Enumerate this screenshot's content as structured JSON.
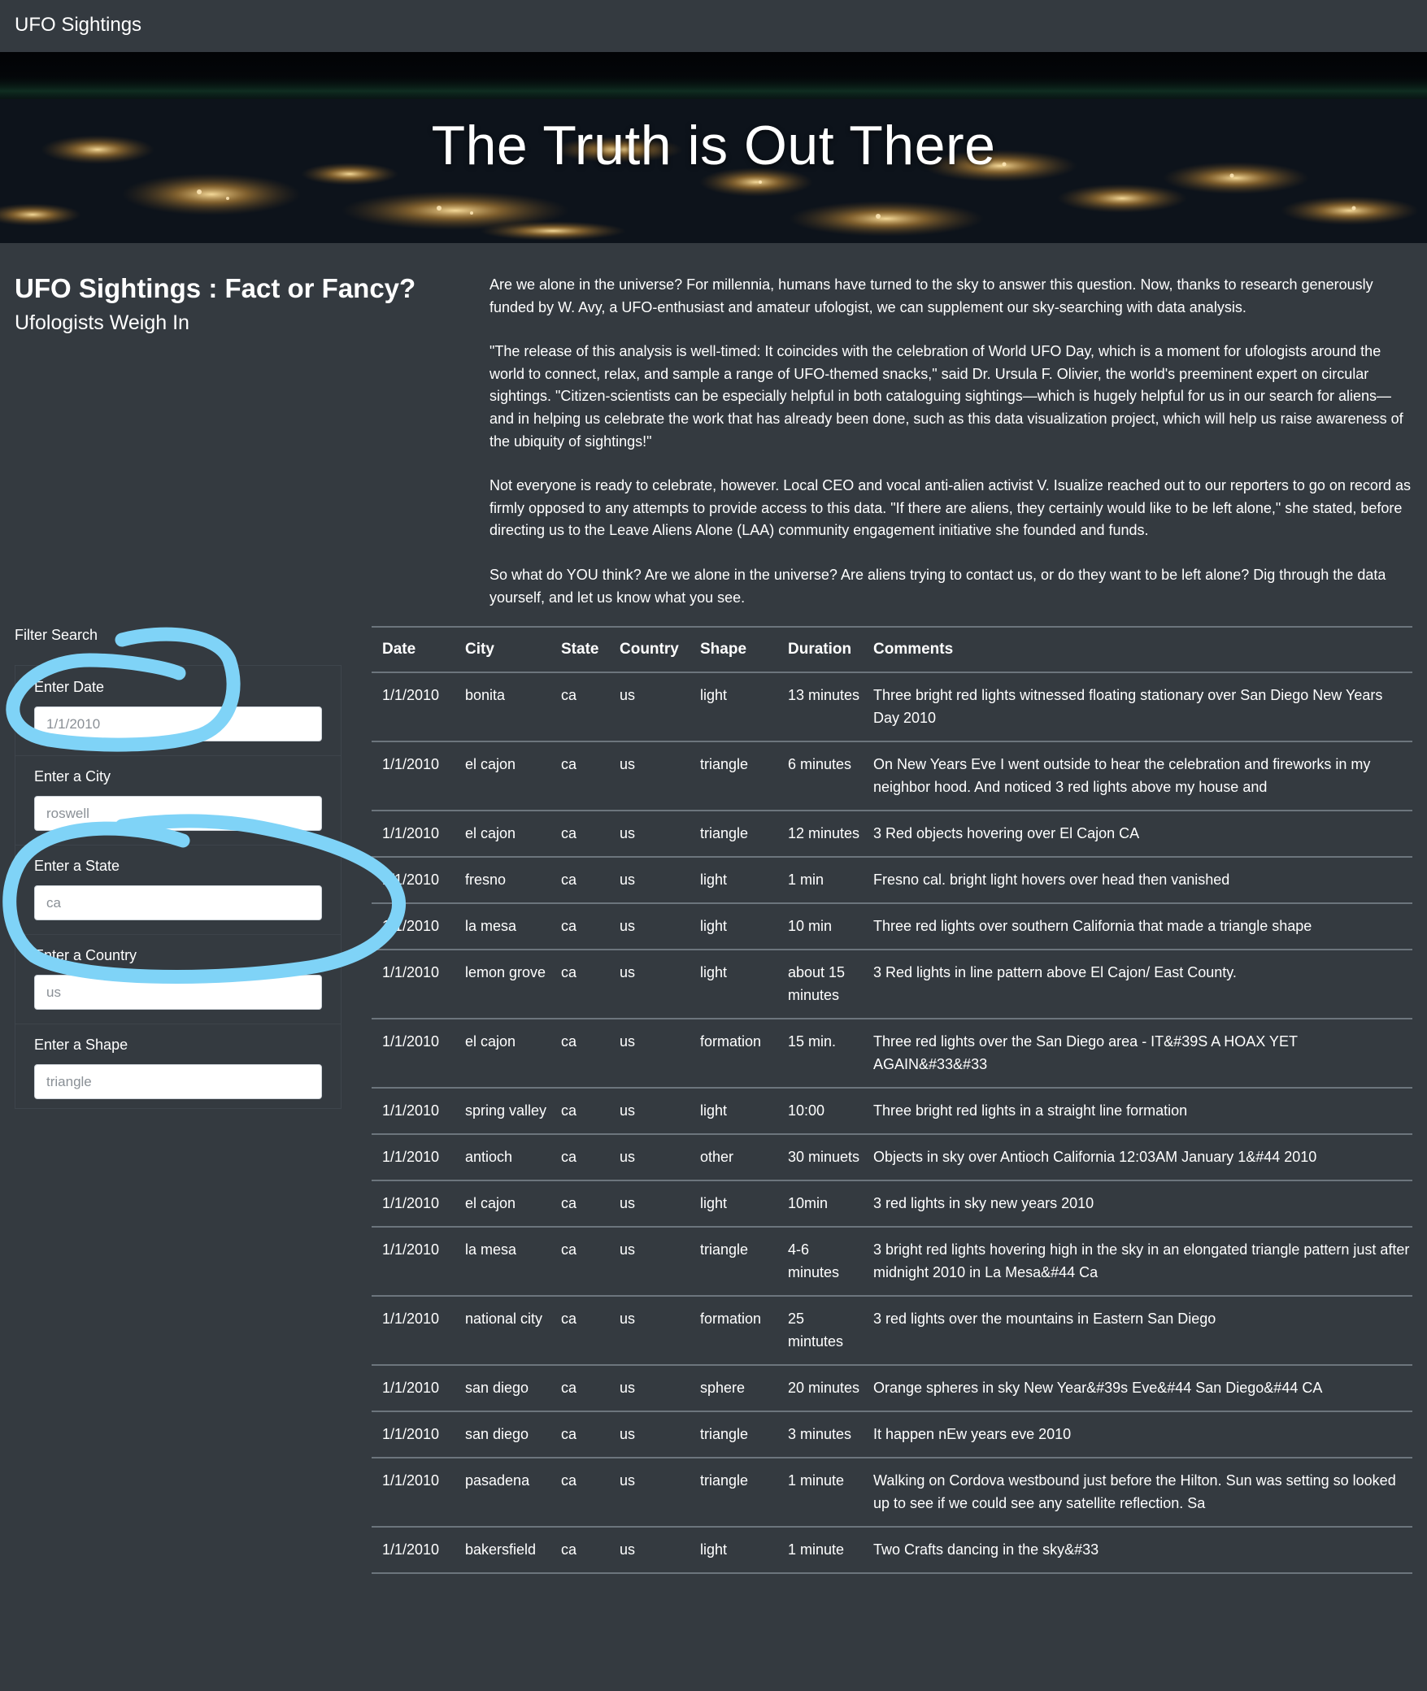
{
  "navbar": {
    "brand": "UFO Sightings"
  },
  "hero": {
    "title": "The Truth is Out There"
  },
  "intro": {
    "title": "UFO Sightings : Fact or Fancy?",
    "subtitle": "Ufologists Weigh In",
    "paragraphs": [
      "Are we alone in the universe? For millennia, humans have turned to the sky to answer this question. Now, thanks to research generously funded by W. Avy, a UFO-enthusiast and amateur ufologist, we can supplement our sky-searching with data analysis.",
      "\"The release of this analysis is well-timed: It coincides with the celebration of World UFO Day, which is a moment for ufologists around the world to connect, relax, and sample a range of UFO-themed snacks,\" said Dr. Ursula F. Olivier, the world's preeminent expert on circular sightings. \"Citizen-scientists can be especially helpful in both cataloguing sightings—which is hugely helpful for us in our search for aliens—and in helping us celebrate the work that has already been done, such as this data visualization project, which will help us raise awareness of the ubiquity of sightings!\"",
      "Not everyone is ready to celebrate, however. Local CEO and vocal anti-alien activist V. Isualize reached out to our reporters to go on record as firmly opposed to any attempts to provide access to this data. \"If there are aliens, they certainly would like to be left alone,\" she stated, before directing us to the Leave Aliens Alone (LAA) community engagement initiative she founded and funds.",
      "So what do YOU think? Are we alone in the universe? Are aliens trying to contact us, or do they want to be left alone? Dig through the data yourself, and let us know what you see."
    ]
  },
  "filters": {
    "heading": "Filter Search",
    "items": [
      {
        "label": "Enter Date",
        "placeholder": "1/1/2010"
      },
      {
        "label": "Enter a City",
        "placeholder": "roswell"
      },
      {
        "label": "Enter a State",
        "placeholder": "ca"
      },
      {
        "label": "Enter a Country",
        "placeholder": "us"
      },
      {
        "label": "Enter a Shape",
        "placeholder": "triangle"
      }
    ]
  },
  "table": {
    "headers": [
      "Date",
      "City",
      "State",
      "Country",
      "Shape",
      "Duration",
      "Comments"
    ],
    "rows": [
      [
        "1/1/2010",
        "bonita",
        "ca",
        "us",
        "light",
        "13 minutes",
        "Three bright red lights witnessed floating stationary over San Diego New Years Day 2010"
      ],
      [
        "1/1/2010",
        "el cajon",
        "ca",
        "us",
        "triangle",
        "6 minutes",
        "On New Years Eve I went outside to hear the celebration and fireworks in my neighbor hood. And noticed 3 red lights above my house and"
      ],
      [
        "1/1/2010",
        "el cajon",
        "ca",
        "us",
        "triangle",
        "12 minutes",
        "3 Red objects hovering over El Cajon CA"
      ],
      [
        "1/1/2010",
        "fresno",
        "ca",
        "us",
        "light",
        "1 min",
        "Fresno cal. bright light hovers over head then vanished"
      ],
      [
        "1/1/2010",
        "la mesa",
        "ca",
        "us",
        "light",
        "10 min",
        "Three red lights over southern California that made a triangle shape"
      ],
      [
        "1/1/2010",
        "lemon grove",
        "ca",
        "us",
        "light",
        "about 15 minutes",
        "3 Red lights in line pattern above El Cajon/ East County."
      ],
      [
        "1/1/2010",
        "el cajon",
        "ca",
        "us",
        "formation",
        "15 min.",
        "Three red lights over the San Diego area - IT&#39S A HOAX YET AGAIN&#33&#33"
      ],
      [
        "1/1/2010",
        "spring valley",
        "ca",
        "us",
        "light",
        "10:00",
        "Three bright red lights in a straight line formation"
      ],
      [
        "1/1/2010",
        "antioch",
        "ca",
        "us",
        "other",
        "30 minuets",
        "Objects in sky over Antioch California 12:03AM January 1&#44 2010"
      ],
      [
        "1/1/2010",
        "el cajon",
        "ca",
        "us",
        "light",
        "10min",
        "3 red lights in sky new years 2010"
      ],
      [
        "1/1/2010",
        "la mesa",
        "ca",
        "us",
        "triangle",
        "4-6 minutes",
        "3 bright red lights hovering high in the sky in an elongated triangle pattern just after midnight 2010 in La Mesa&#44 Ca"
      ],
      [
        "1/1/2010",
        "national city",
        "ca",
        "us",
        "formation",
        "25 mintutes",
        "3 red lights over the mountains in Eastern San Diego"
      ],
      [
        "1/1/2010",
        "san diego",
        "ca",
        "us",
        "sphere",
        "20 minutes",
        "Orange spheres in sky New Year&#39s Eve&#44 San Diego&#44 CA"
      ],
      [
        "1/1/2010",
        "san diego",
        "ca",
        "us",
        "triangle",
        "3 minutes",
        "It happen nEw years eve 2010"
      ],
      [
        "1/1/2010",
        "pasadena",
        "ca",
        "us",
        "triangle",
        "1 minute",
        "Walking on Cordova westbound just before the Hilton. Sun was setting so looked up to see if we could see any satellite reflection. Sa"
      ],
      [
        "1/1/2010",
        "bakersfield",
        "ca",
        "us",
        "light",
        "1 minute",
        "Two Crafts dancing in the sky&#33"
      ]
    ]
  },
  "colors": {
    "background": "#343a40",
    "annotation": "#7fd3f7",
    "table_border": "#6c757d"
  }
}
